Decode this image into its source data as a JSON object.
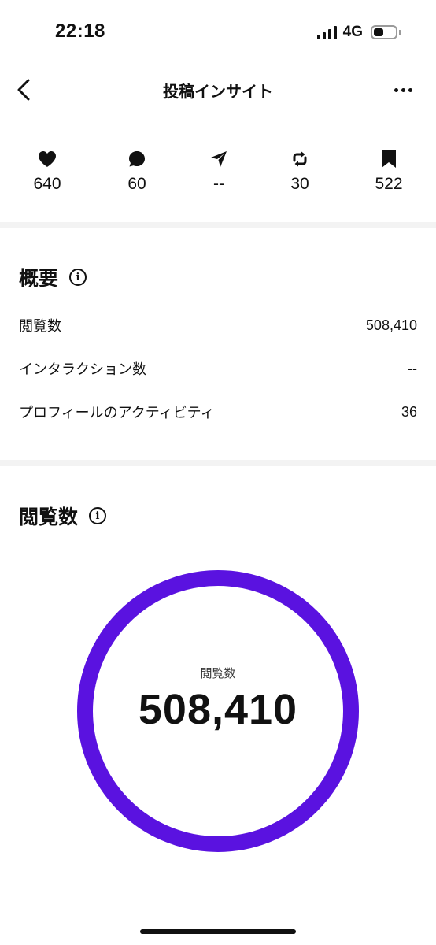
{
  "status_bar": {
    "time": "22:18",
    "network": "4G",
    "battery_level": 0.45
  },
  "header": {
    "title": "投稿インサイト",
    "back_icon": "chevron-left-icon",
    "more_icon": "more-horizontal-icon"
  },
  "stats": [
    {
      "icon": "heart-icon",
      "value": "640"
    },
    {
      "icon": "comment-icon",
      "value": "60"
    },
    {
      "icon": "share-icon",
      "value": "--"
    },
    {
      "icon": "repost-icon",
      "value": "30"
    },
    {
      "icon": "bookmark-icon",
      "value": "522"
    }
  ],
  "overview": {
    "title": "概要",
    "rows": [
      {
        "label": "閲覧数",
        "value": "508,410"
      },
      {
        "label": "インタラクション数",
        "value": "--"
      },
      {
        "label": "プロフィールのアクティビティ",
        "value": "36"
      }
    ]
  },
  "views": {
    "title": "閲覧数",
    "ring_label": "閲覧数",
    "ring_value": "508,410",
    "ring_color": "#5a12e0",
    "ring_fraction": 1.0
  },
  "colors": {
    "accent": "#5a12e0",
    "text": "#111111",
    "divider": "#f3f3f3"
  }
}
